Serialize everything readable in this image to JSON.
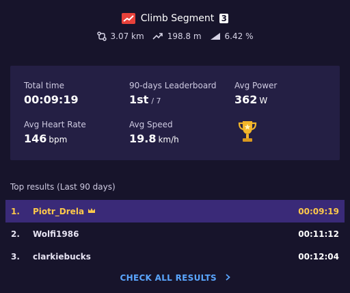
{
  "header": {
    "title": "Climb Segment",
    "category": "3",
    "distance": "3.07 km",
    "elevation": "198.8 m",
    "grade": "6.42 %"
  },
  "stats": {
    "total_time": {
      "label": "Total time",
      "value": "00:09:19"
    },
    "leaderboard": {
      "label": "90-days Leaderboard",
      "value": "1st",
      "sub": "/ 7"
    },
    "avg_power": {
      "label": "Avg Power",
      "value": "362",
      "unit": "W"
    },
    "avg_heart_rate": {
      "label": "Avg Heart Rate",
      "value": "146",
      "unit": "bpm"
    },
    "avg_speed": {
      "label": "Avg Speed",
      "value": "19.8",
      "unit": "km/h"
    }
  },
  "top_results": {
    "label": "Top results (Last 90 days)",
    "rows": [
      {
        "rank": "1.",
        "name": "Piotr_Drela",
        "time": "00:09:19"
      },
      {
        "rank": "2.",
        "name": "Wolfi1986",
        "time": "00:11:12"
      },
      {
        "rank": "3.",
        "name": "clarkiebucks",
        "time": "00:12:04"
      }
    ]
  },
  "check_all_label": "CHECK ALL RESULTS",
  "colors": {
    "background": "#17142b",
    "card": "#241f44",
    "highlight_row": "#3a2a78",
    "gold": "#ffc94a",
    "link": "#5aa6ff",
    "segment_red": "#e8413a"
  },
  "icons": {
    "segment": "climb-segment-icon",
    "distance": "route-icon",
    "elevation": "trend-up-icon",
    "grade": "gradient-icon",
    "trophy": "trophy-icon",
    "crown": "crown-icon",
    "chevron": "chevron-right-icon"
  }
}
